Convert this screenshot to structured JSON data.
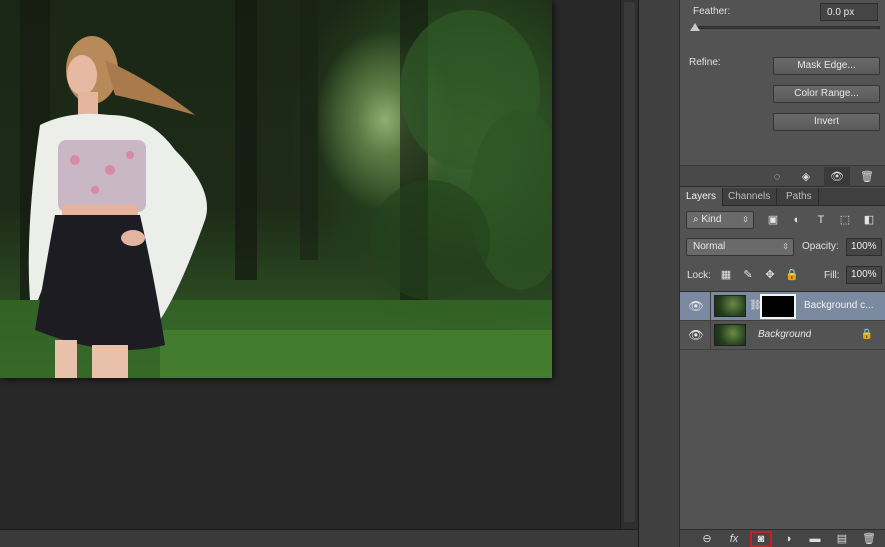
{
  "properties": {
    "feather_label": "Feather:",
    "feather_value": "0.0 px",
    "refine_label": "Refine:",
    "buttons": [
      "Mask Edge...",
      "Color Range...",
      "Invert"
    ],
    "toolbar_icons": [
      "selection-from-mask-icon",
      "apply-mask-icon",
      "disable-mask-eye-icon",
      "delete-mask-icon"
    ]
  },
  "layers_panel": {
    "tabs": [
      "Layers",
      "Channels",
      "Paths"
    ],
    "active_tab": "Layers",
    "filter_kind": "Kind",
    "filter_icons": [
      "pixel-filter-icon",
      "adjustment-filter-icon",
      "type-filter-icon",
      "shape-filter-icon",
      "smart-object-filter-icon"
    ],
    "blend_mode": "Normal",
    "opacity_label": "Opacity:",
    "opacity_value": "100%",
    "lock_label": "Lock:",
    "lock_icons": [
      "lock-transparent-icon",
      "lock-image-icon",
      "lock-position-icon",
      "lock-all-icon"
    ],
    "fill_label": "Fill:",
    "fill_value": "100%",
    "layers": [
      {
        "name": "Background c...",
        "selected": true,
        "has_mask": true,
        "visible": true
      },
      {
        "name": "Background",
        "selected": false,
        "has_mask": false,
        "visible": true,
        "locked": true
      }
    ],
    "bottom_icons": [
      "link-layers-icon",
      "fx-icon",
      "add-mask-icon",
      "adjustment-layer-icon",
      "group-icon",
      "new-layer-icon",
      "delete-layer-icon"
    ],
    "fx_label": "fx"
  },
  "colors": {
    "panel_bg": "#535353",
    "selected_layer": "#7b8aa0",
    "highlight_box": "#c81e1e"
  }
}
